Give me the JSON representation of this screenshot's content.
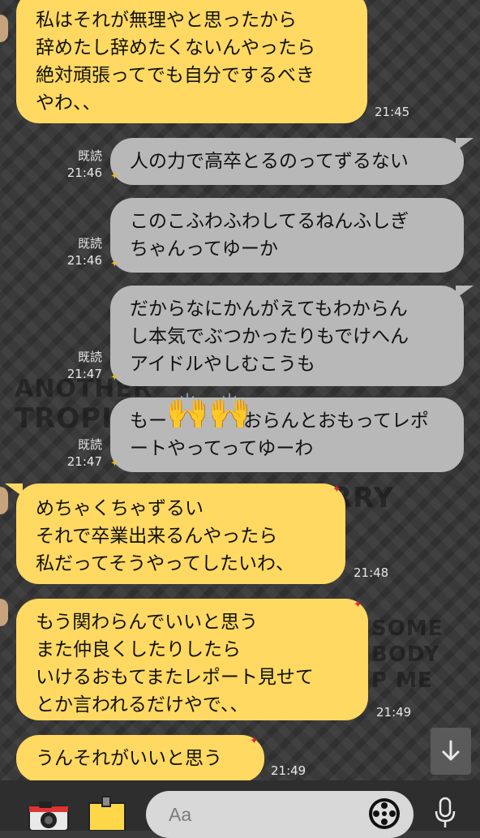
{
  "chat": {
    "messages": [
      {
        "side": "incoming",
        "lines": [
          "私はそれが無理やと思ったから",
          "辞めたし辞めたくないんやったら",
          "絶対頑張ってでも自分でするべき",
          "やわ、、"
        ],
        "time": "21:45"
      },
      {
        "side": "outgoing",
        "lines": [
          "人の力で高卒とるのってずるない"
        ],
        "read": "既読",
        "time": "21:46"
      },
      {
        "side": "outgoing",
        "lines": [
          "このこふわふわしてるねんふしぎ",
          "ちゃんってゆーか"
        ],
        "read": "既読",
        "time": "21:46"
      },
      {
        "side": "outgoing",
        "lines": [
          "だからなにかんがえてもわからん",
          "し本気でぶつかったりもでけへん",
          "アイドルやしむこうも"
        ],
        "read": "既読",
        "time": "21:47"
      },
      {
        "side": "outgoing",
        "lines": [
          "もー",
          "おらんとおもってレポ",
          "ートやってってゆーわ"
        ],
        "emoji": "🙌🙌",
        "read": "既読",
        "time": "21:47"
      },
      {
        "side": "incoming",
        "lines": [
          "めちゃくちゃずるい",
          "それで卒業出来るんやったら",
          "私だってそうやってしたいわ、"
        ],
        "time": "21:48"
      },
      {
        "side": "incoming",
        "lines": [
          "もう関わらんでいいと思う",
          "また仲良くしたりしたら",
          "いけるおもてまたレポート見せて",
          "とか言われるだけやで、、"
        ],
        "time": "21:49"
      },
      {
        "side": "incoming",
        "lines": [
          "うんそれがいいと思う"
        ],
        "time": "21:49"
      }
    ]
  },
  "background": {
    "texts": [
      "ANOTHER",
      "TROPI",
      "RRY",
      "SOME",
      "BODY",
      "P ME"
    ]
  },
  "composer": {
    "placeholder": "Aa",
    "icons": [
      "camera-icon",
      "photo-icon",
      "sticker-icon",
      "microphone-icon"
    ]
  },
  "scroll_button": {
    "icon": "arrow-down-icon"
  },
  "colors": {
    "incoming": "#ffd962",
    "outgoing": "#b8b8b8",
    "background": "#3a3a3a"
  }
}
